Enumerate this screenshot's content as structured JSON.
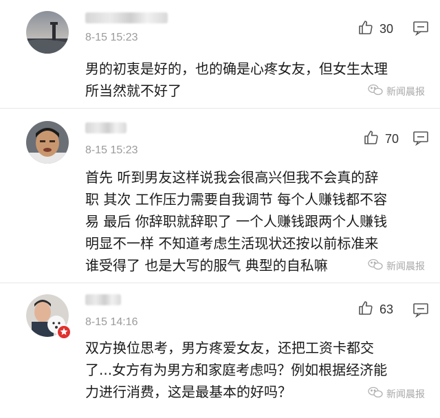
{
  "comments": [
    {
      "date": "8-15 15:23",
      "likes": "30",
      "lines": [
        "男的初衷是好的，也的确是心疼女友，但女生太理",
        "所当然就不好了"
      ],
      "watermark": "新闻晨报"
    },
    {
      "date": "8-15 15:23",
      "likes": "70",
      "lines": [
        "首先 听到男友这样说我会很高兴但我不会真的辞",
        "职 其次 工作压力需要自我调节 每个人赚钱都不容",
        "易 最后 你辞职就辞职了 一个人赚钱跟两个人赚钱",
        "明显不一样 不知道考虑生活现状还按以前标准来",
        "谁受得了 也是大写的服气 典型的自私嘛"
      ],
      "watermark": "新闻晨报"
    },
    {
      "date": "8-15 14:16",
      "likes": "63",
      "lines": [
        "双方换位思考，男方疼爱女友，还把工资卡都交",
        "了...女方有为男方和家庭考虑吗？例如根据经济能",
        "力进行消费，这是最基本的好吗？"
      ],
      "watermark": "新闻晨报"
    }
  ],
  "icons": {
    "like": "thumbs-up-icon",
    "reply": "comment-bubble-icon",
    "watermark": "wechat-logo-icon"
  }
}
